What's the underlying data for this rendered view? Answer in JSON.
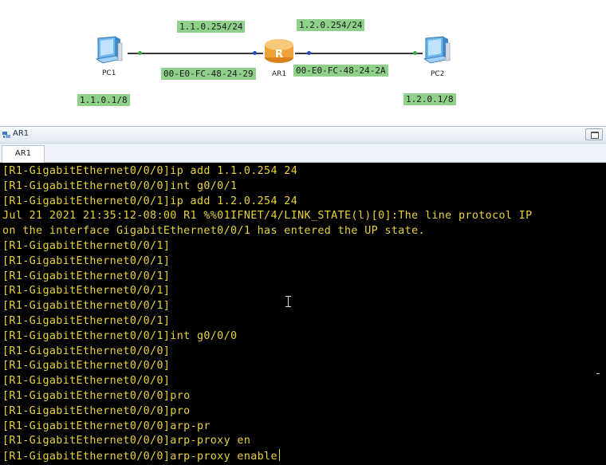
{
  "topology": {
    "devices": [
      {
        "id": "pc1",
        "label": "PC1",
        "icon": "pc-icon"
      },
      {
        "id": "ar1",
        "label": "AR1",
        "icon": "router-icon"
      },
      {
        "id": "pc2",
        "label": "PC2",
        "icon": "pc-icon"
      }
    ],
    "labels": {
      "ar1_g0_ip": "1.1.0.254/24",
      "ar1_g1_ip": "1.2.0.254/24",
      "ar1_g0_mac": "00-E0-FC-48-24-29",
      "ar1_g1_mac": "00-E0-FC-48-24-2A",
      "pc1_ip": "1.1.0.1/8",
      "pc2_ip": "1.2.0.1/8"
    },
    "colors": {
      "label_bg": "#8fd18b",
      "router": "#f2a640",
      "pc_screen": "#5aa9e6",
      "port_left": "#3cb043",
      "port_router": "#1e50c8"
    }
  },
  "window": {
    "title": "AR1",
    "tab": "AR1",
    "icon": "device-window-icon",
    "restore_button_icon": "restore-window-icon"
  },
  "console": {
    "text_color": "#e8d23a",
    "background": "#000000",
    "lines": [
      "[R1-GigabitEthernet0/0/0]ip add 1.1.0.254 24",
      "[R1-GigabitEthernet0/0/0]int g0/0/1",
      "[R1-GigabitEthernet0/0/1]ip add 1.2.0.254 24",
      "Jul 21 2021 21:35:12-08:00 R1 %%01IFNET/4/LINK_STATE(l)[0]:The line protocol IP",
      "on the interface GigabitEthernet0/0/1 has entered the UP state.",
      "[R1-GigabitEthernet0/0/1]",
      "[R1-GigabitEthernet0/0/1]",
      "[R1-GigabitEthernet0/0/1]",
      "[R1-GigabitEthernet0/0/1]",
      "[R1-GigabitEthernet0/0/1]",
      "[R1-GigabitEthernet0/0/1]",
      "[R1-GigabitEthernet0/0/1]int g0/0/0",
      "[R1-GigabitEthernet0/0/0]",
      "[R1-GigabitEthernet0/0/0]",
      "[R1-GigabitEthernet0/0/0]",
      "[R1-GigabitEthernet0/0/0]pro",
      "[R1-GigabitEthernet0/0/0]pro",
      "[R1-GigabitEthernet0/0/0]arp-pr",
      "[R1-GigabitEthernet0/0/0]arp-proxy en",
      "[R1-GigabitEthernet0/0/0]arp-proxy enable"
    ]
  }
}
